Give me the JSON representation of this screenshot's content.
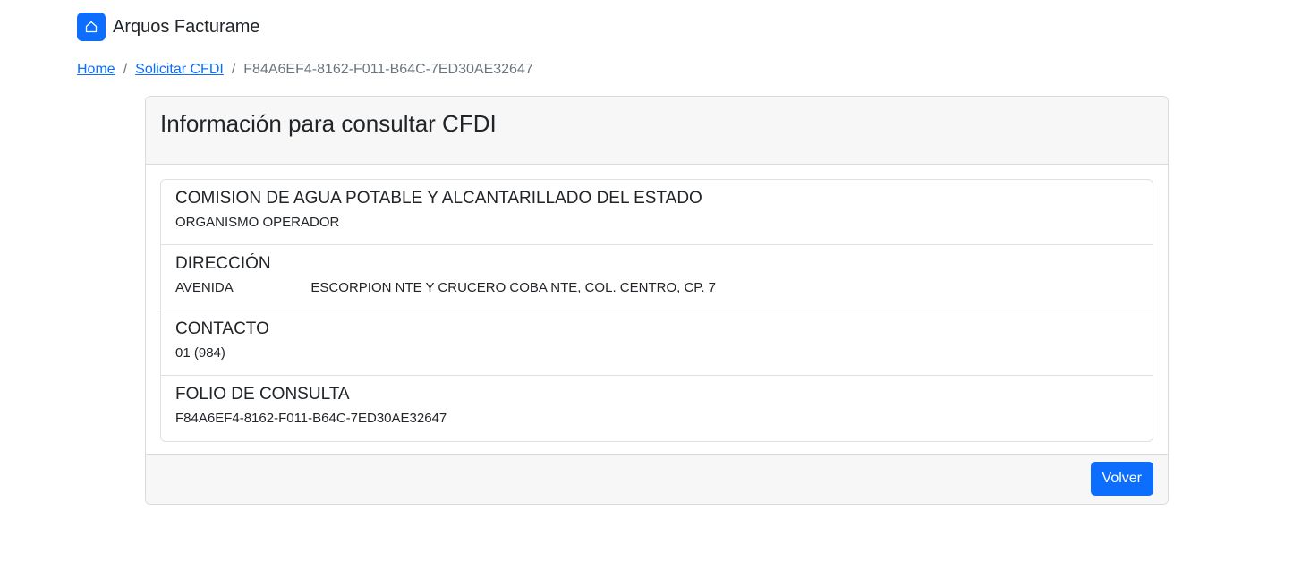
{
  "brand": {
    "name": "Arquos Facturame",
    "icon": "home-icon",
    "color": "#0d6efd"
  },
  "breadcrumb": {
    "items": [
      {
        "label": "Home"
      },
      {
        "label": "Solicitar CFDI"
      }
    ],
    "separator": "/",
    "active": "F84A6EF4-8162-F011-B64C-7ED30AE32647"
  },
  "card": {
    "title": "Información para consultar CFDI",
    "items": [
      {
        "heading": "COMISION DE AGUA POTABLE Y ALCANTARILLADO DEL ESTADO",
        "text": "ORGANISMO OPERADOR"
      },
      {
        "heading": "DIRECCIÓN",
        "text": "AVENIDA                     ESCORPION NTE Y CRUCERO COBA NTE, COL. CENTRO, CP. 7"
      },
      {
        "heading": "CONTACTO",
        "text": "01 (984)"
      },
      {
        "heading": "FOLIO DE CONSULTA",
        "text": "F84A6EF4-8162-F011-B64C-7ED30AE32647"
      }
    ],
    "button_label": "Volver"
  }
}
